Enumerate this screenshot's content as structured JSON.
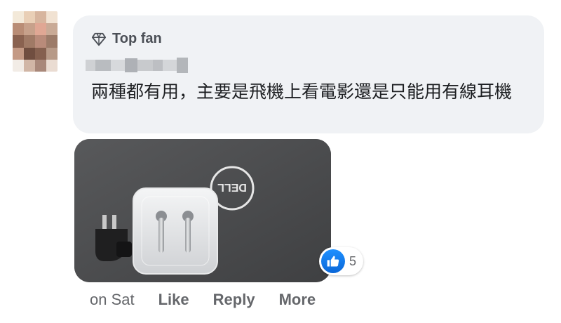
{
  "comment": {
    "badge_label": "Top fan",
    "text": "兩種都有用，主要是飛機上看電影還是只能用有線耳機"
  },
  "reactions": {
    "icon": "thumbs-up-icon",
    "count": "5",
    "color": "#1877f2"
  },
  "actions": {
    "timestamp": "on Sat",
    "like_label": "Like",
    "reply_label": "Reply",
    "more_label": "More"
  },
  "photo": {
    "logo_text": "DELL"
  }
}
